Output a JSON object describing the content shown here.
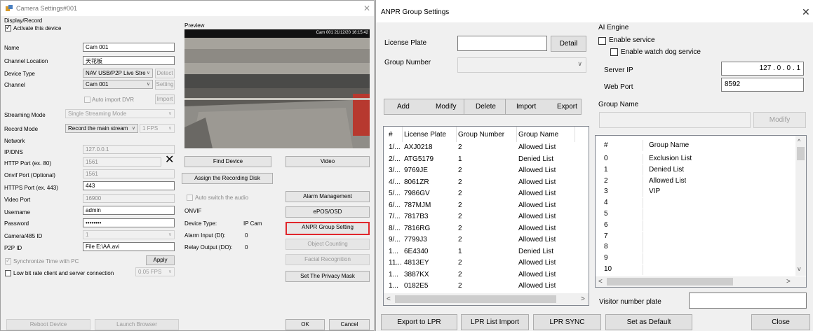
{
  "camera_dialog": {
    "title": "Camera Settings#001",
    "display_record": {
      "group_title": "Display/Record",
      "activate_label": "Activate this device",
      "activate_checked": true,
      "name_label": "Name",
      "name_value": "Cam 001",
      "location_label": "Channel Location",
      "location_value": "天花板",
      "device_type_label": "Device Type",
      "device_type_value": "NAV USB/P2P Live Stre",
      "detect_label": "Detect",
      "channel_label": "Channel",
      "channel_value": "Cam 001",
      "setting_label": "Setting",
      "auto_import_label": "Auto import DVR",
      "import_label": "Import",
      "streaming_mode_label": "Streaming Mode",
      "streaming_mode_value": "Single Streaming Mode",
      "record_mode_label": "Record Mode",
      "record_mode_value": "Record the main stream",
      "fps_value": "1 FPS"
    },
    "network": {
      "group_title": "Network",
      "ip_label": "IP/DNS",
      "ip_value": "127.0.0.1",
      "http_label": "HTTP Port (ex. 80)",
      "http_value": "1561",
      "onvif_port_label": "Onvif Port (Optional)",
      "onvif_port_value": "1561",
      "https_label": "HTTPS Port (ex. 443)",
      "https_value": "443",
      "video_port_label": "Video Port",
      "video_port_value": "16900",
      "username_label": "Username",
      "username_value": "admin",
      "password_label": "Password",
      "password_value": "••••••••",
      "cam485_label": "Camera/485 ID",
      "cam485_value": "1",
      "p2p_label": "P2P ID",
      "p2p_value": "File E:\\AA.avi",
      "sync_label": "Synchronize Time with PC",
      "apply_label": "Apply",
      "lowbit_label": "Low bit rate client and server connection",
      "lowbit_fps": "0.05 FPS"
    },
    "preview": {
      "group_title": "Preview",
      "overlay_text": "Cam 001 21/12/20 16:15:42",
      "find_device": "Find Device",
      "video": "Video",
      "assign_disk": "Assign the Recording Disk",
      "auto_switch_audio": "Auto switch the audio"
    },
    "onvif": {
      "group_title": "ONVIF",
      "device_type_label": "Device Type:",
      "device_type_value": "IP Cam",
      "alarm_input_label": "Alarm Input (DI):",
      "alarm_input_value": "0",
      "relay_output_label": "Relay Output (DO):",
      "relay_output_value": "0"
    },
    "right_buttons": {
      "alarm_management": "Alarm Management",
      "epos_osd": "ePOS/OSD",
      "anpr_group_setting": "ANPR Group Setting",
      "object_counting": "Object Counting",
      "facial_recognition": "Facial Recognition",
      "privacy_mask": "Set The Privacy Mask"
    },
    "footer": {
      "reboot": "Reboot Device",
      "launch_browser": "Launch Browser",
      "ok": "OK",
      "cancel": "Cancel"
    }
  },
  "anpr_dialog": {
    "title": "ANPR Group Settings",
    "license_plate_label": "License Plate",
    "license_plate_value": "",
    "detail_label": "Detail",
    "group_number_label": "Group Number",
    "group_number_value": "",
    "actions": {
      "add": "Add",
      "modify": "Modify",
      "delete": "Delete",
      "import": "Import",
      "export": "Export"
    },
    "plate_table": {
      "headers": [
        "#",
        "License Plate",
        "Group Number",
        "Group Name"
      ],
      "rows": [
        [
          "1/...",
          "AXJ0218",
          "2",
          "Allowed List"
        ],
        [
          "2/...",
          "ATG5179",
          "1",
          "Denied List"
        ],
        [
          "3/...",
          "9769JE",
          "2",
          "Allowed List"
        ],
        [
          "4/...",
          "8061ZR",
          "2",
          "Allowed List"
        ],
        [
          "5/...",
          "7986GV",
          "2",
          "Allowed List"
        ],
        [
          "6/...",
          "787MJM",
          "2",
          "Allowed List"
        ],
        [
          "7/...",
          "7817B3",
          "2",
          "Allowed List"
        ],
        [
          "8/...",
          "7816RG",
          "2",
          "Allowed List"
        ],
        [
          "9/...",
          "7799J3",
          "2",
          "Allowed List"
        ],
        [
          "1...",
          "6E4340",
          "1",
          "Denied List"
        ],
        [
          "11...",
          "4813EY",
          "2",
          "Allowed List"
        ],
        [
          "1...",
          "3887KX",
          "2",
          "Allowed List"
        ],
        [
          "1...",
          "0182E5",
          "2",
          "Allowed List"
        ]
      ]
    },
    "ai_engine": {
      "group_title": "AI Engine",
      "enable_service_label": "Enable service",
      "enable_watchdog_label": "Enable watch dog service",
      "server_ip_label": "Server IP",
      "server_ip_value": "127 .  0  .  0  .  1",
      "web_port_label": "Web Port",
      "web_port_value": "8592"
    },
    "group_name_label": "Group Name",
    "group_name_value": "",
    "group_modify_label": "Modify",
    "group_table": {
      "headers": [
        "#",
        "Group Name"
      ],
      "rows": [
        [
          "0",
          "Exclusion List"
        ],
        [
          "1",
          "Denied List"
        ],
        [
          "2",
          "Allowed List"
        ],
        [
          "3",
          "VIP"
        ],
        [
          "4",
          ""
        ],
        [
          "5",
          ""
        ],
        [
          "6",
          ""
        ],
        [
          "7",
          ""
        ],
        [
          "8",
          ""
        ],
        [
          "9",
          ""
        ],
        [
          "10",
          ""
        ]
      ]
    },
    "visitor_plate_label": "Visitor number plate",
    "visitor_plate_value": "",
    "footer": {
      "export_lpr": "Export to LPR",
      "lpr_list_import": "LPR List Import",
      "lpr_sync": "LPR SYNC",
      "set_default": "Set as Default",
      "close": "Close"
    }
  }
}
